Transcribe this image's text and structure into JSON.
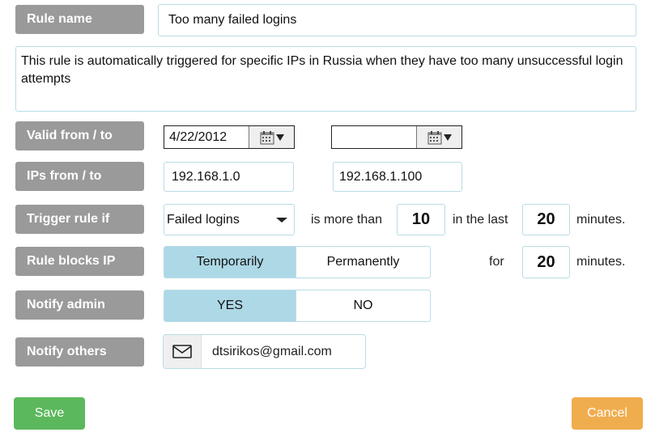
{
  "rule_name": {
    "label": "Rule name",
    "value": "Too many failed logins"
  },
  "description": {
    "value": "This rule is automatically triggered for specific IPs in Russia when they have too many unsuccessful login attempts"
  },
  "valid": {
    "label": "Valid from / to",
    "from": "4/22/2012",
    "to": ""
  },
  "ips": {
    "label": "IPs from / to",
    "from": "192.168.1.0",
    "to": "192.168.1.100"
  },
  "trigger": {
    "label": "Trigger rule if",
    "condition": "Failed logins",
    "is_more_than": "is more than",
    "count": "10",
    "in_the_last": "in the last",
    "minutes_value": "20",
    "minutes_label": "minutes."
  },
  "blocks": {
    "label": "Rule blocks IP",
    "options": [
      "Temporarily",
      "Permanently"
    ],
    "selected": "Temporarily",
    "for_label": "for",
    "minutes_value": "20",
    "minutes_label": "minutes."
  },
  "notify_admin": {
    "label": "Notify admin",
    "options": [
      "YES",
      "NO"
    ],
    "selected": "YES"
  },
  "notify_others": {
    "label": "Notify others",
    "email": "dtsirikos@gmail.com",
    "icon": "envelope-icon"
  },
  "buttons": {
    "save": "Save",
    "cancel": "Cancel"
  },
  "colors": {
    "label_bg": "#9a9a9a",
    "selected_bg": "#add8e6",
    "save": "#5cb85c",
    "cancel": "#f0ad4e",
    "field_border": "#b9dce6"
  }
}
